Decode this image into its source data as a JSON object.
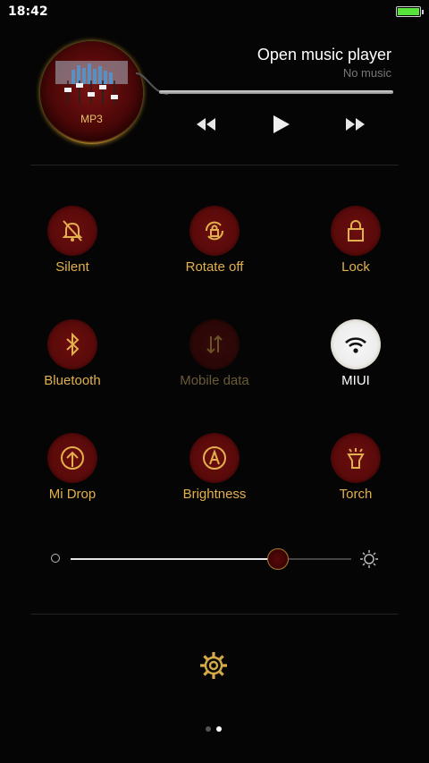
{
  "status_bar": {
    "time": "18:42",
    "battery_level": 1.0,
    "battery_color": "#57e33a"
  },
  "music": {
    "title": "Open music player",
    "subtitle": "No music",
    "album_label": "MP3",
    "progress": 1.0,
    "controls": [
      "rewind-icon",
      "play-icon",
      "fast-forward-icon"
    ]
  },
  "toggles": [
    {
      "label": "Silent",
      "icon": "bell-off-icon",
      "state": "normal"
    },
    {
      "label": "Rotate off",
      "icon": "rotation-lock-icon",
      "state": "normal"
    },
    {
      "label": "Lock",
      "icon": "lock-icon",
      "state": "normal"
    },
    {
      "label": "Bluetooth",
      "icon": "bluetooth-icon",
      "state": "normal"
    },
    {
      "label": "Mobile data",
      "icon": "mobile-data-icon",
      "state": "disabled"
    },
    {
      "label": "MIUI",
      "icon": "wifi-icon",
      "state": "active"
    },
    {
      "label": "Mi Drop",
      "icon": "upload-icon",
      "state": "normal"
    },
    {
      "label": "Brightness",
      "icon": "auto-brightness-icon",
      "state": "normal"
    },
    {
      "label": "Torch",
      "icon": "flashlight-icon",
      "state": "normal"
    }
  ],
  "brightness": {
    "level": 0.74
  },
  "pager": {
    "pages": 2,
    "current": 1
  },
  "colors": {
    "gold": "#e2b04c",
    "maroon": "#5a0a0a",
    "background": "#050505"
  }
}
